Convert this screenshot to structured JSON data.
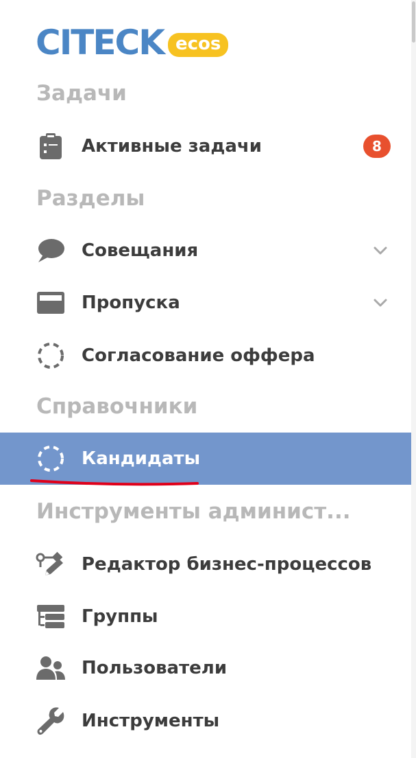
{
  "logo": {
    "word": "CITECK",
    "badge": "ecos",
    "colors": {
      "word": "#4b86c5",
      "badge_bg": "#f7c221"
    }
  },
  "sections": [
    {
      "title": "Задачи"
    },
    {
      "title": "Разделы"
    },
    {
      "title": "Справочники"
    },
    {
      "title": "Инструменты админист..."
    }
  ],
  "items": {
    "active_tasks": {
      "label": "Активные задачи",
      "icon": "clipboard-icon",
      "badge": "8"
    },
    "meetings": {
      "label": "Совещания",
      "icon": "speech-bubble-icon",
      "expandable": true
    },
    "passes": {
      "label": "Пропуска",
      "icon": "card-icon",
      "expandable": true
    },
    "offer_approval": {
      "label": "Согласование оффера",
      "icon": "dashed-circle-icon"
    },
    "candidates": {
      "label": "Кандидаты",
      "icon": "dashed-circle-icon",
      "active": true
    },
    "bp_editor": {
      "label": "Редактор бизнес-процессов",
      "icon": "process-editor-icon"
    },
    "groups": {
      "label": "Группы",
      "icon": "groups-icon"
    },
    "users": {
      "label": "Пользователи",
      "icon": "users-icon"
    },
    "tools": {
      "label": "Инструменты",
      "icon": "wrench-icon"
    }
  },
  "colors": {
    "active_bg": "#7396cc",
    "section_title": "#b8b8b8",
    "item_text": "#3c3c3c",
    "icon": "#6b6b6b",
    "badge_bg": "#e8502e",
    "annotation_underline": "#e0001a"
  }
}
